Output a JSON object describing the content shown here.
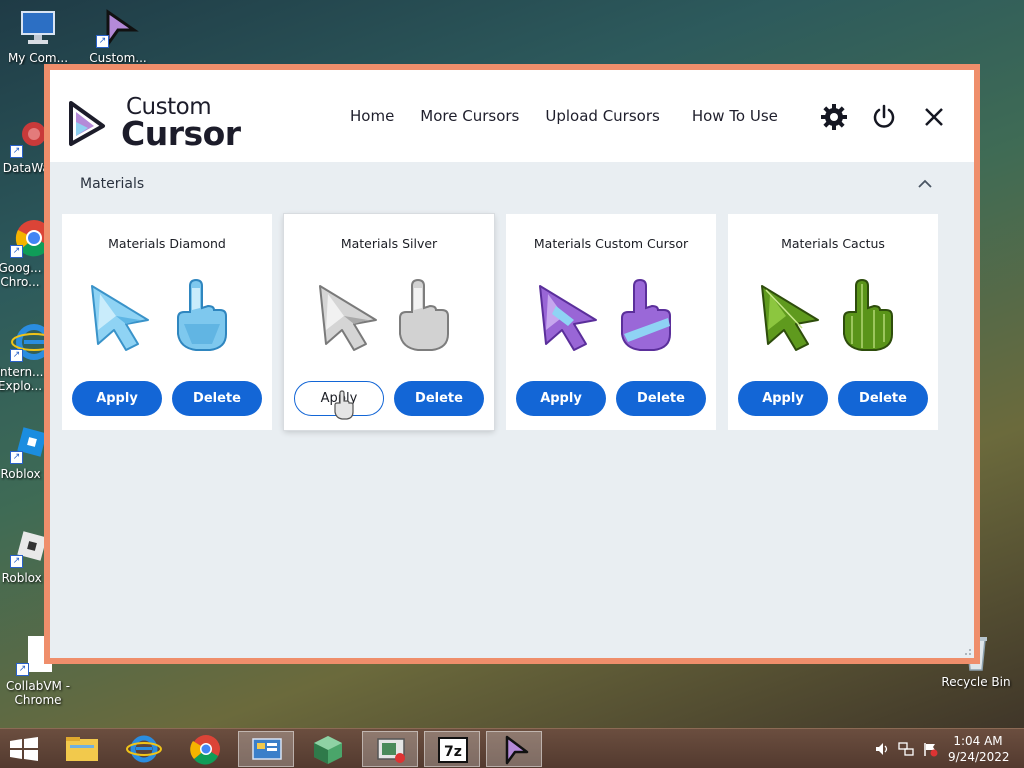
{
  "desktop": {
    "icons": [
      {
        "label": "My Com..."
      },
      {
        "label": "Custom..."
      },
      {
        "label": "DataWa..."
      },
      {
        "label": "Goog... Chro..."
      },
      {
        "label": "Intern... Explo..."
      },
      {
        "label": "Roblox S..."
      },
      {
        "label": "Roblox P..."
      },
      {
        "label": "CollabVM - Chrome"
      },
      {
        "label": "Recycle Bin"
      }
    ]
  },
  "app": {
    "logo": {
      "line1": "Custom",
      "line2": "Cursor"
    },
    "nav": [
      "Home",
      "More Cursors",
      "Upload Cursors",
      "How To Use"
    ],
    "header_icons": [
      "gear-icon",
      "power-icon",
      "close-icon"
    ],
    "section": {
      "title": "Materials"
    },
    "cards": [
      {
        "title": "Materials Diamond",
        "apply_label": "Apply",
        "delete_label": "Delete",
        "color": "#7fc9ef"
      },
      {
        "title": "Materials Silver",
        "apply_label": "Apply",
        "delete_label": "Delete",
        "color": "#c9c9c9"
      },
      {
        "title": "Materials Custom Cursor",
        "apply_label": "Apply",
        "delete_label": "Delete",
        "color": "#9a6ad8"
      },
      {
        "title": "Materials Cactus",
        "apply_label": "Apply",
        "delete_label": "Delete",
        "color": "#5f9a1e"
      }
    ],
    "colors": {
      "accent": "#1366d6",
      "window_border": "#ef8e6b"
    }
  },
  "taskbar": {
    "items": [
      "start-icon",
      "file-explorer-icon",
      "internet-explorer-icon",
      "chrome-icon",
      "control-panel-icon",
      "cube-app-icon",
      "recording-app-icon",
      "7zip-icon",
      "custom-cursor-app-icon"
    ],
    "clock": {
      "time": "1:04 AM",
      "date": "9/24/2022"
    }
  }
}
